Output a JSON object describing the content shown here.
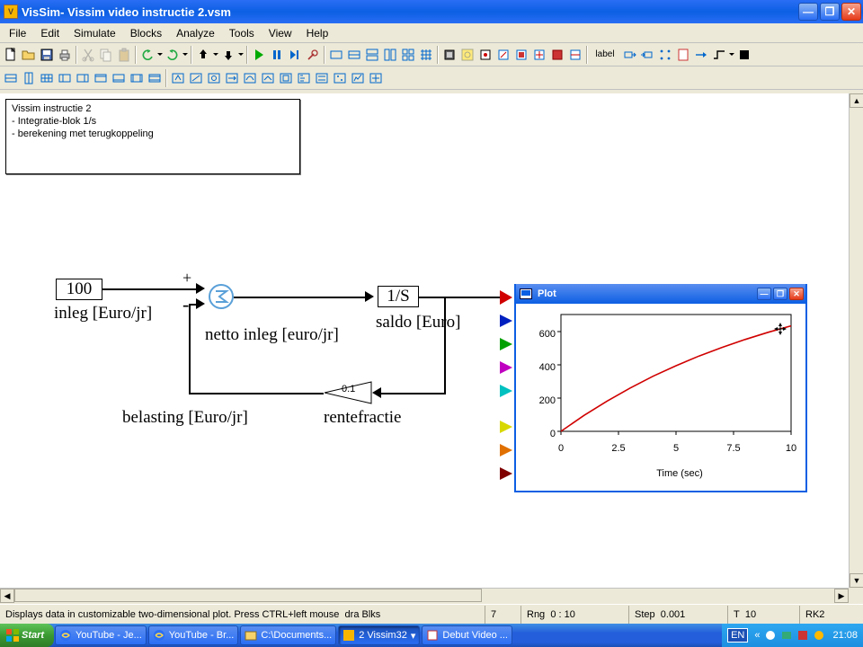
{
  "window": {
    "title": "VisSim- Vissim video instructie 2.vsm"
  },
  "menus": [
    "File",
    "Edit",
    "Simulate",
    "Blocks",
    "Analyze",
    "Tools",
    "View",
    "Help"
  ],
  "note": {
    "line1": "Vissim instructie 2",
    "line2": "- Integratie-blok 1/s",
    "line3": "- berekening met terugkoppeling"
  },
  "diagram": {
    "const_value": "100",
    "const_label": "inleg [Euro/jr]",
    "sum_plus": "+",
    "sum_minus": "-",
    "netto_label": "netto inleg [euro/jr]",
    "integrator": "1/S",
    "saldo_label": "saldo [Euro]",
    "gain_value": "0.1",
    "gain_label": "rentefractie",
    "belasting_label": "belasting [Euro/jr]"
  },
  "plot": {
    "title": "Plot",
    "xlabel": "Time (sec)",
    "xticks": [
      "0",
      "2.5",
      "5",
      "7.5",
      "10"
    ],
    "yticks": [
      "0",
      "200",
      "400",
      "600"
    ]
  },
  "chart_data": {
    "type": "line",
    "title": "Plot",
    "xlabel": "Time (sec)",
    "ylabel": "",
    "xlim": [
      0,
      10
    ],
    "ylim": [
      0,
      700
    ],
    "x": [
      0,
      1,
      2,
      3,
      4,
      5,
      6,
      7,
      8,
      9,
      10
    ],
    "series": [
      {
        "name": "saldo",
        "color": "#d00000",
        "values": [
          0,
          95,
          181,
          259,
          330,
          393,
          451,
          503,
          550,
          593,
          632
        ]
      }
    ]
  },
  "status": {
    "help": "Displays data in customizable two-dimensional plot. Press CTRL+left mouse",
    "drablks_label": "dra Blks",
    "drablks": "7",
    "rng_label": "Rng",
    "rng": "0 : 10",
    "step_label": "Step",
    "step": "0.001",
    "t_label": "T",
    "t": "10",
    "method": "RK2"
  },
  "taskbar": {
    "start": "Start",
    "tasks": [
      {
        "label": "YouTube - Je...",
        "icon": "ie"
      },
      {
        "label": "YouTube - Br...",
        "icon": "ie"
      },
      {
        "label": "C:\\Documents...",
        "icon": "folder"
      },
      {
        "label": "2 Vissim32",
        "icon": "vissim",
        "active": true,
        "dropdown": true
      },
      {
        "label": "Debut Video ...",
        "icon": "app"
      }
    ],
    "tray": {
      "lang": "EN",
      "time": "21:08"
    }
  }
}
